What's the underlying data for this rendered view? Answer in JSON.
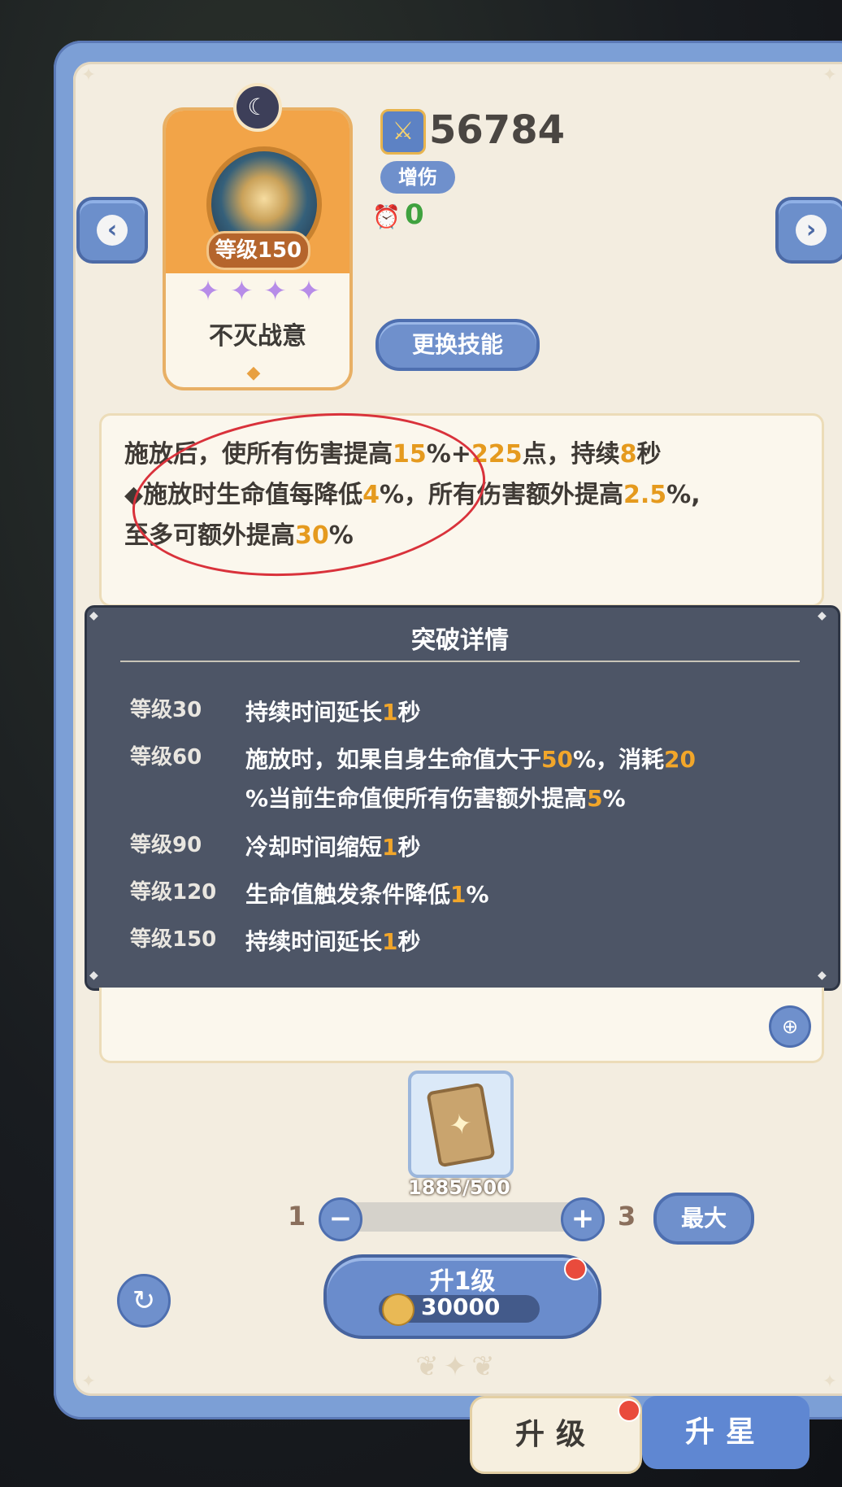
{
  "power": "56784",
  "tag": "增伤",
  "cooldown": "0",
  "level_badge": "等级150",
  "skill_name": "不灭战意",
  "change_skill": "更换技能",
  "description": [
    [
      "施放后，使所有伤害提高",
      "15",
      "%+",
      "225",
      "点，持续",
      "8",
      "秒"
    ],
    [
      "◆施放时生命值每降低",
      "4",
      "%，所有伤害额外提高",
      "2.5",
      "%,"
    ],
    [
      "至多可额外提高",
      "30",
      "%"
    ]
  ],
  "overlay": {
    "title": "突破详情",
    "rows": [
      {
        "level": "等级30",
        "parts": [
          "持续时间延长",
          "1",
          "秒"
        ]
      },
      {
        "level": "等级60",
        "parts": [
          "施放时，如果自身生命值大于",
          "50",
          "%，消耗",
          "20"
        ],
        "parts2": [
          "%当前生命值使所有伤害额外提高",
          "5",
          "%"
        ]
      },
      {
        "level": "等级90",
        "parts": [
          "冷却时间缩短",
          "1",
          "秒"
        ]
      },
      {
        "level": "等级120",
        "parts": [
          "生命值触发条件降低",
          "1",
          "%"
        ]
      },
      {
        "level": "等级150",
        "parts": [
          "持续时间延长",
          "1",
          "秒"
        ]
      }
    ]
  },
  "item_count": "1885/500",
  "slider": {
    "min": "1",
    "max": "3",
    "minus": "−",
    "plus": "+"
  },
  "max_label": "最大",
  "upgrade": {
    "label": "升1级",
    "cost": "30000"
  },
  "tabs": {
    "upgrade": "升级",
    "star": "升星"
  },
  "icons": {
    "prev": "chevron-left-icon",
    "next": "chevron-right-icon",
    "power": "sword-shield-icon",
    "cooldown": "alarm-clock-icon"
  },
  "colors": {
    "highlight": "#e59a1e",
    "accent": "#6f90cc",
    "annotation_circle": "#d9323b"
  }
}
